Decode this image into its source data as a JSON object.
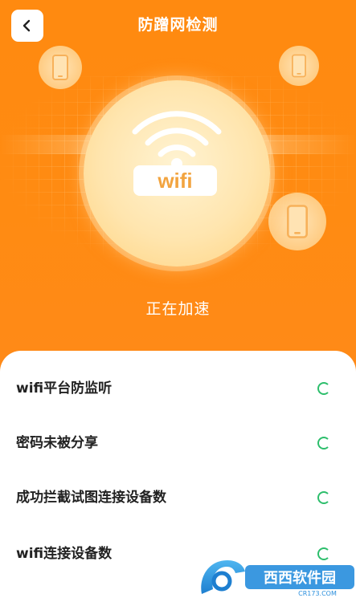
{
  "header": {
    "title": "防蹭网检测",
    "back_icon": "chevron-left-icon"
  },
  "hero": {
    "badge_text": "wifi",
    "status_text": "正在加速"
  },
  "checks": [
    {
      "label": "wifi平台防监听",
      "state": "loading"
    },
    {
      "label": "密码未被分享",
      "state": "loading"
    },
    {
      "label": "成功拦截试图连接设备数",
      "state": "loading"
    },
    {
      "label": "wifi连接设备数",
      "state": "loading"
    }
  ],
  "colors": {
    "accent": "#FF8A10",
    "spinner": "#2DBE6C",
    "wifi_text": "#F2A440"
  },
  "watermark": {
    "text": "西西软件园",
    "sub": "CR173.COM"
  }
}
